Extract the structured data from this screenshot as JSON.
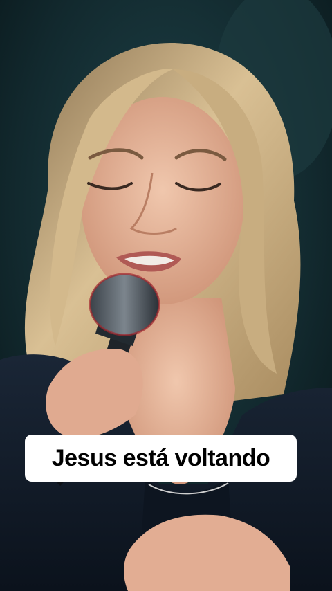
{
  "caption": {
    "text": "Jesus está voltando"
  },
  "colors": {
    "background": "#0f2a2e",
    "caption_bg": "#ffffff",
    "caption_text": "#000000",
    "hair": "#c9ab7c",
    "skin": "#e8b89e",
    "jacket": "#121c2a"
  },
  "scene": {
    "subject": "singer-with-microphone"
  }
}
